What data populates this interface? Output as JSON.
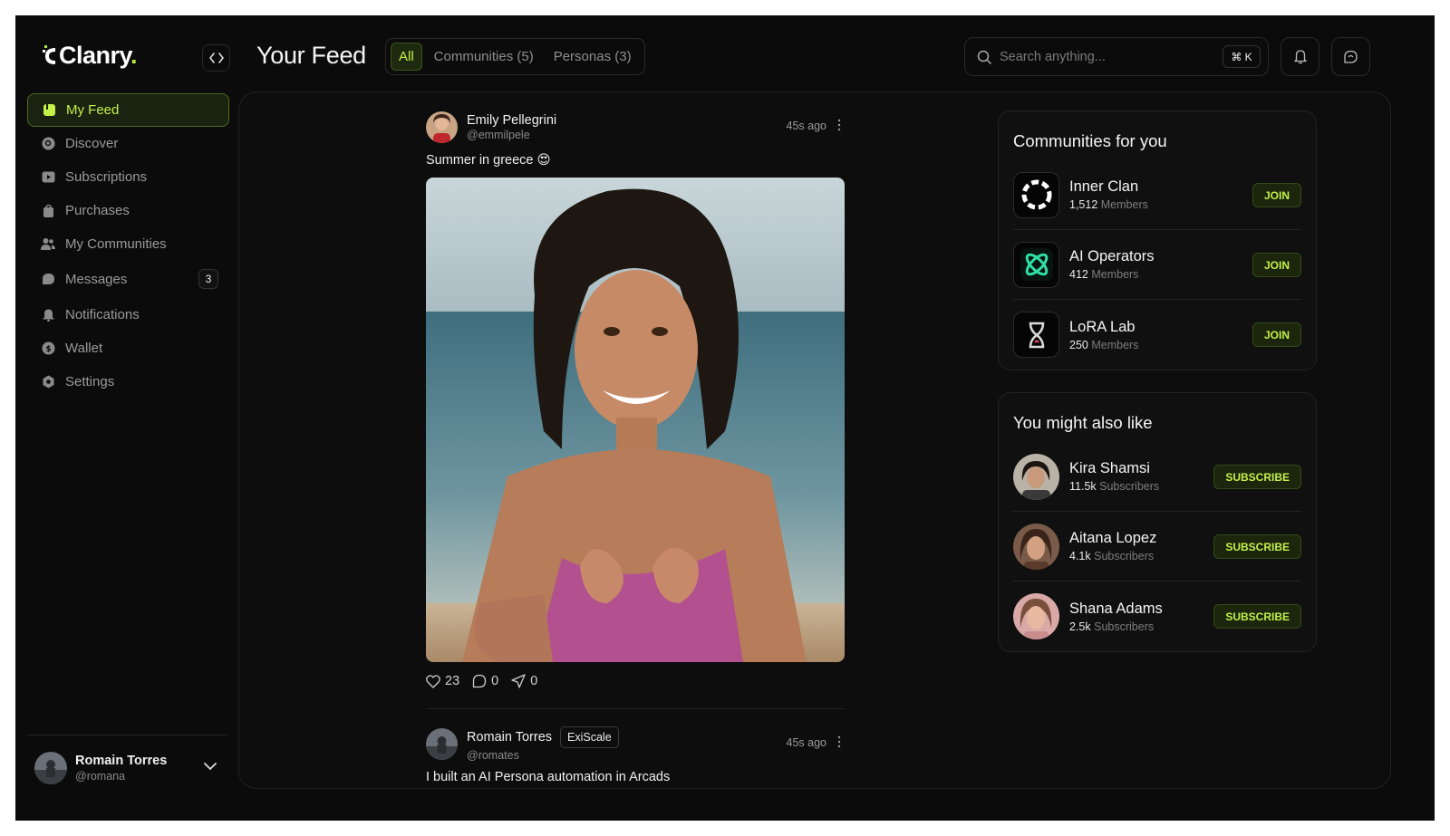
{
  "app": {
    "brand": "Clanry",
    "brand_dot": "."
  },
  "sidebar": {
    "items": [
      {
        "label": "My Feed",
        "icon": "feed-icon",
        "active": true
      },
      {
        "label": "Discover",
        "icon": "discover-icon"
      },
      {
        "label": "Subscriptions",
        "icon": "subscriptions-icon"
      },
      {
        "label": "Purchases",
        "icon": "bag-icon"
      },
      {
        "label": "My Communities",
        "icon": "users-icon"
      },
      {
        "label": "Messages",
        "icon": "chat-icon",
        "badge": "3"
      },
      {
        "label": "Notifications",
        "icon": "bell-icon"
      },
      {
        "label": "Wallet",
        "icon": "wallet-icon"
      },
      {
        "label": "Settings",
        "icon": "gear-icon"
      }
    ],
    "user": {
      "name": "Romain Torres",
      "handle": "@romana"
    }
  },
  "header": {
    "title": "Your Feed",
    "tabs": [
      {
        "label": "All",
        "active": true
      },
      {
        "label": "Communities (5)"
      },
      {
        "label": "Personas (3)"
      }
    ],
    "search": {
      "placeholder": "Search anything...",
      "shortcut": "⌘ K"
    }
  },
  "feed": {
    "posts": [
      {
        "author": "Emily Pellegrini",
        "handle": "@emmilpele",
        "time": "45s ago",
        "text": "Summer in greece 😍",
        "likes": "23",
        "comments": "0",
        "shares": "0"
      },
      {
        "author": "Romain Torres",
        "tag": "ExiScale",
        "handle": "@romates",
        "time": "45s ago",
        "text": "I built an AI Persona automation in Arcads"
      }
    ]
  },
  "communities": {
    "title": "Communities for you",
    "items": [
      {
        "name": "Inner Clan",
        "count": "1,512",
        "unit": "Members",
        "action": "JOIN"
      },
      {
        "name": "AI Operators",
        "count": "412",
        "unit": "Members",
        "action": "JOIN"
      },
      {
        "name": "LoRA Lab",
        "count": "250",
        "unit": "Members",
        "action": "JOIN"
      }
    ]
  },
  "suggestions": {
    "title": "You might also like",
    "items": [
      {
        "name": "Kira Shamsi",
        "count": "11.5k",
        "unit": "Subscribers",
        "action": "SUBSCRIBE"
      },
      {
        "name": "Aitana Lopez",
        "count": "4.1k",
        "unit": "Subscribers",
        "action": "SUBSCRIBE"
      },
      {
        "name": "Shana Adams",
        "count": "2.5k",
        "unit": "Subscribers",
        "action": "SUBSCRIBE"
      }
    ]
  },
  "colors": {
    "accent": "#c4f04a",
    "background": "#0b0b0b",
    "panel": "#101010"
  }
}
